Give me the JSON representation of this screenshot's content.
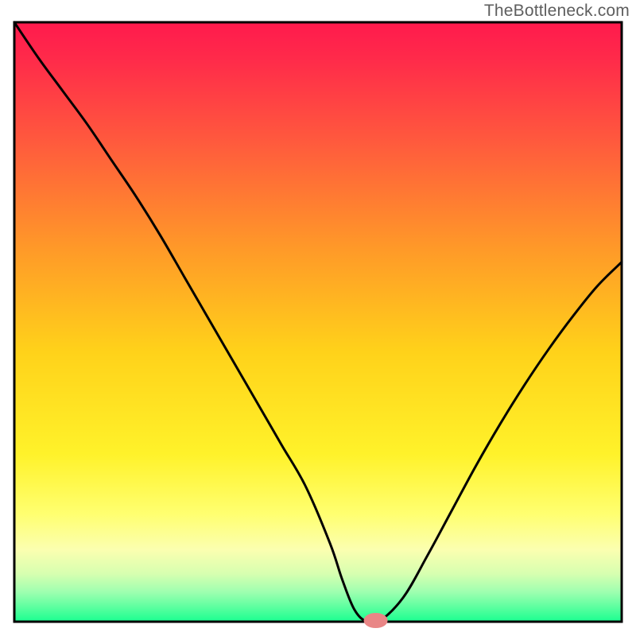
{
  "attribution": "TheBottleneck.com",
  "colors": {
    "border": "#000000",
    "gradient_stops": [
      {
        "offset": 0.0,
        "color": "#ff1a4d"
      },
      {
        "offset": 0.06,
        "color": "#ff2a4a"
      },
      {
        "offset": 0.2,
        "color": "#ff5a3d"
      },
      {
        "offset": 0.38,
        "color": "#ff9a28"
      },
      {
        "offset": 0.55,
        "color": "#ffd21a"
      },
      {
        "offset": 0.72,
        "color": "#fff22a"
      },
      {
        "offset": 0.82,
        "color": "#ffff70"
      },
      {
        "offset": 0.88,
        "color": "#fbffb0"
      },
      {
        "offset": 0.92,
        "color": "#d7ffb0"
      },
      {
        "offset": 0.95,
        "color": "#9fffb0"
      },
      {
        "offset": 0.975,
        "color": "#5effa0"
      },
      {
        "offset": 1.0,
        "color": "#1aff90"
      }
    ],
    "curve": "#000000",
    "marker_fill": "#e98686",
    "marker_stroke": "#e98686"
  },
  "chart_data": {
    "type": "line",
    "title": "",
    "xlabel": "",
    "ylabel": "",
    "xlim": [
      0,
      100
    ],
    "ylim": [
      0,
      100
    ],
    "grid": false,
    "legend": false,
    "series": [
      {
        "name": "bottleneck-curve",
        "x": [
          0,
          4,
          8,
          12,
          16,
          20,
          24,
          28,
          32,
          36,
          40,
          44,
          48,
          52,
          54,
          56,
          58,
          60,
          64,
          68,
          72,
          76,
          80,
          84,
          88,
          92,
          96,
          100
        ],
        "y": [
          100,
          94,
          88.5,
          83,
          77,
          71,
          64.5,
          57.5,
          50.5,
          43.5,
          36.5,
          29.5,
          22.5,
          13,
          7,
          2,
          0,
          0,
          4,
          11,
          18.5,
          26,
          33,
          39.5,
          45.5,
          51,
          56,
          60
        ]
      }
    ],
    "marker": {
      "x": 59.5,
      "y": 0.2,
      "rx": 1.9,
      "ry": 1.2
    }
  }
}
